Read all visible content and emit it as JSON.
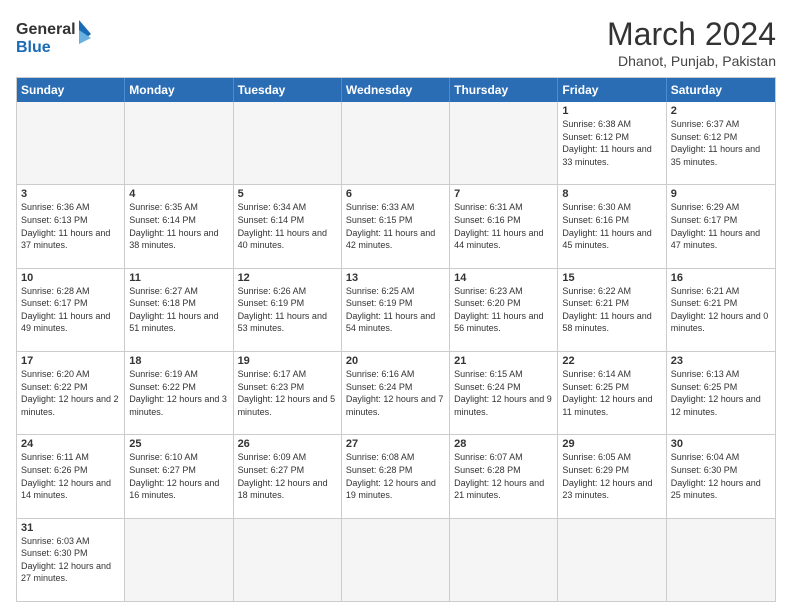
{
  "header": {
    "logo_general": "General",
    "logo_blue": "Blue",
    "month_year": "March 2024",
    "location": "Dhanot, Punjab, Pakistan"
  },
  "days_of_week": [
    "Sunday",
    "Monday",
    "Tuesday",
    "Wednesday",
    "Thursday",
    "Friday",
    "Saturday"
  ],
  "weeks": [
    [
      {
        "day": "",
        "empty": true
      },
      {
        "day": "",
        "empty": true
      },
      {
        "day": "",
        "empty": true
      },
      {
        "day": "",
        "empty": true
      },
      {
        "day": "",
        "empty": true
      },
      {
        "day": "1",
        "sunrise": "6:38 AM",
        "sunset": "6:12 PM",
        "daylight": "11 hours and 33 minutes."
      },
      {
        "day": "2",
        "sunrise": "6:37 AM",
        "sunset": "6:12 PM",
        "daylight": "11 hours and 35 minutes."
      }
    ],
    [
      {
        "day": "3",
        "sunrise": "6:36 AM",
        "sunset": "6:13 PM",
        "daylight": "11 hours and 37 minutes."
      },
      {
        "day": "4",
        "sunrise": "6:35 AM",
        "sunset": "6:14 PM",
        "daylight": "11 hours and 38 minutes."
      },
      {
        "day": "5",
        "sunrise": "6:34 AM",
        "sunset": "6:14 PM",
        "daylight": "11 hours and 40 minutes."
      },
      {
        "day": "6",
        "sunrise": "6:33 AM",
        "sunset": "6:15 PM",
        "daylight": "11 hours and 42 minutes."
      },
      {
        "day": "7",
        "sunrise": "6:31 AM",
        "sunset": "6:16 PM",
        "daylight": "11 hours and 44 minutes."
      },
      {
        "day": "8",
        "sunrise": "6:30 AM",
        "sunset": "6:16 PM",
        "daylight": "11 hours and 45 minutes."
      },
      {
        "day": "9",
        "sunrise": "6:29 AM",
        "sunset": "6:17 PM",
        "daylight": "11 hours and 47 minutes."
      }
    ],
    [
      {
        "day": "10",
        "sunrise": "6:28 AM",
        "sunset": "6:17 PM",
        "daylight": "11 hours and 49 minutes."
      },
      {
        "day": "11",
        "sunrise": "6:27 AM",
        "sunset": "6:18 PM",
        "daylight": "11 hours and 51 minutes."
      },
      {
        "day": "12",
        "sunrise": "6:26 AM",
        "sunset": "6:19 PM",
        "daylight": "11 hours and 53 minutes."
      },
      {
        "day": "13",
        "sunrise": "6:25 AM",
        "sunset": "6:19 PM",
        "daylight": "11 hours and 54 minutes."
      },
      {
        "day": "14",
        "sunrise": "6:23 AM",
        "sunset": "6:20 PM",
        "daylight": "11 hours and 56 minutes."
      },
      {
        "day": "15",
        "sunrise": "6:22 AM",
        "sunset": "6:21 PM",
        "daylight": "11 hours and 58 minutes."
      },
      {
        "day": "16",
        "sunrise": "6:21 AM",
        "sunset": "6:21 PM",
        "daylight": "12 hours and 0 minutes."
      }
    ],
    [
      {
        "day": "17",
        "sunrise": "6:20 AM",
        "sunset": "6:22 PM",
        "daylight": "12 hours and 2 minutes."
      },
      {
        "day": "18",
        "sunrise": "6:19 AM",
        "sunset": "6:22 PM",
        "daylight": "12 hours and 3 minutes."
      },
      {
        "day": "19",
        "sunrise": "6:17 AM",
        "sunset": "6:23 PM",
        "daylight": "12 hours and 5 minutes."
      },
      {
        "day": "20",
        "sunrise": "6:16 AM",
        "sunset": "6:24 PM",
        "daylight": "12 hours and 7 minutes."
      },
      {
        "day": "21",
        "sunrise": "6:15 AM",
        "sunset": "6:24 PM",
        "daylight": "12 hours and 9 minutes."
      },
      {
        "day": "22",
        "sunrise": "6:14 AM",
        "sunset": "6:25 PM",
        "daylight": "12 hours and 11 minutes."
      },
      {
        "day": "23",
        "sunrise": "6:13 AM",
        "sunset": "6:25 PM",
        "daylight": "12 hours and 12 minutes."
      }
    ],
    [
      {
        "day": "24",
        "sunrise": "6:11 AM",
        "sunset": "6:26 PM",
        "daylight": "12 hours and 14 minutes."
      },
      {
        "day": "25",
        "sunrise": "6:10 AM",
        "sunset": "6:27 PM",
        "daylight": "12 hours and 16 minutes."
      },
      {
        "day": "26",
        "sunrise": "6:09 AM",
        "sunset": "6:27 PM",
        "daylight": "12 hours and 18 minutes."
      },
      {
        "day": "27",
        "sunrise": "6:08 AM",
        "sunset": "6:28 PM",
        "daylight": "12 hours and 19 minutes."
      },
      {
        "day": "28",
        "sunrise": "6:07 AM",
        "sunset": "6:28 PM",
        "daylight": "12 hours and 21 minutes."
      },
      {
        "day": "29",
        "sunrise": "6:05 AM",
        "sunset": "6:29 PM",
        "daylight": "12 hours and 23 minutes."
      },
      {
        "day": "30",
        "sunrise": "6:04 AM",
        "sunset": "6:30 PM",
        "daylight": "12 hours and 25 minutes."
      }
    ],
    [
      {
        "day": "31",
        "sunrise": "6:03 AM",
        "sunset": "6:30 PM",
        "daylight": "12 hours and 27 minutes."
      },
      {
        "day": "",
        "empty": true
      },
      {
        "day": "",
        "empty": true
      },
      {
        "day": "",
        "empty": true
      },
      {
        "day": "",
        "empty": true
      },
      {
        "day": "",
        "empty": true
      },
      {
        "day": "",
        "empty": true
      }
    ]
  ]
}
